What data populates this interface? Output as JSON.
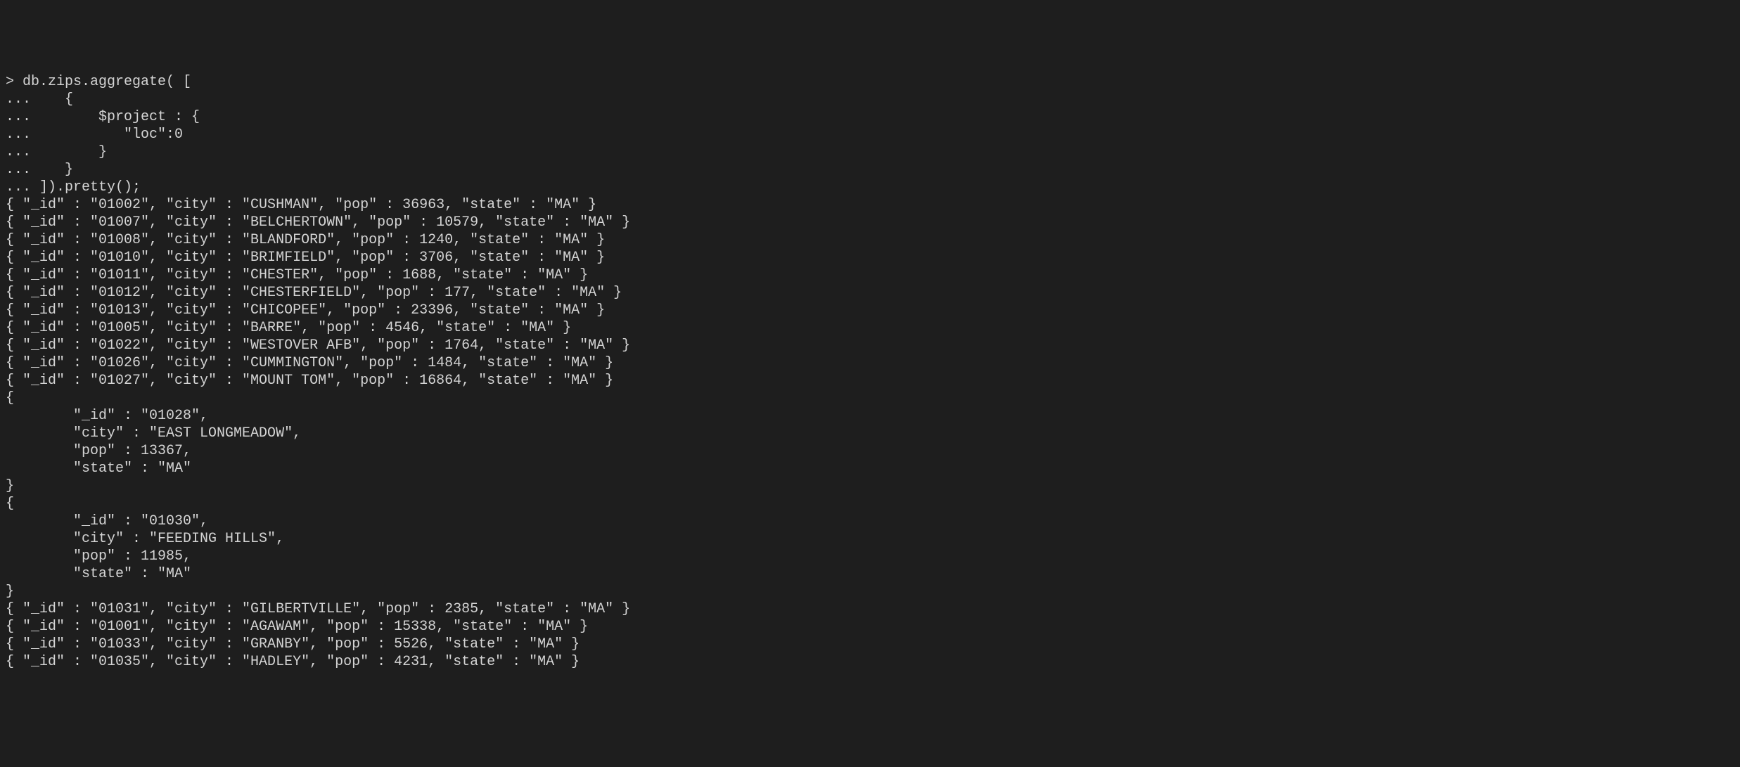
{
  "prompt": "> ",
  "command_lines": [
    "db.zips.aggregate( [",
    "...    {",
    "...        $project : {",
    "...           \"loc\":0",
    "...        }",
    "...    }",
    "... ]).pretty();"
  ],
  "results_inline": [
    {
      "_id": "01002",
      "city": "CUSHMAN",
      "pop": 36963,
      "state": "MA"
    },
    {
      "_id": "01007",
      "city": "BELCHERTOWN",
      "pop": 10579,
      "state": "MA"
    },
    {
      "_id": "01008",
      "city": "BLANDFORD",
      "pop": 1240,
      "state": "MA"
    },
    {
      "_id": "01010",
      "city": "BRIMFIELD",
      "pop": 3706,
      "state": "MA"
    },
    {
      "_id": "01011",
      "city": "CHESTER",
      "pop": 1688,
      "state": "MA"
    },
    {
      "_id": "01012",
      "city": "CHESTERFIELD",
      "pop": 177,
      "state": "MA"
    },
    {
      "_id": "01013",
      "city": "CHICOPEE",
      "pop": 23396,
      "state": "MA"
    },
    {
      "_id": "01005",
      "city": "BARRE",
      "pop": 4546,
      "state": "MA"
    },
    {
      "_id": "01022",
      "city": "WESTOVER AFB",
      "pop": 1764,
      "state": "MA"
    },
    {
      "_id": "01026",
      "city": "CUMMINGTON",
      "pop": 1484,
      "state": "MA"
    },
    {
      "_id": "01027",
      "city": "MOUNT TOM",
      "pop": 16864,
      "state": "MA"
    }
  ],
  "results_pretty": [
    {
      "_id": "01028",
      "city": "EAST LONGMEADOW",
      "pop": 13367,
      "state": "MA"
    },
    {
      "_id": "01030",
      "city": "FEEDING HILLS",
      "pop": 11985,
      "state": "MA"
    }
  ],
  "results_inline2": [
    {
      "_id": "01031",
      "city": "GILBERTVILLE",
      "pop": 2385,
      "state": "MA"
    },
    {
      "_id": "01001",
      "city": "AGAWAM",
      "pop": 15338,
      "state": "MA"
    },
    {
      "_id": "01033",
      "city": "GRANBY",
      "pop": 5526,
      "state": "MA"
    },
    {
      "_id": "01035",
      "city": "HADLEY",
      "pop": 4231,
      "state": "MA"
    }
  ]
}
